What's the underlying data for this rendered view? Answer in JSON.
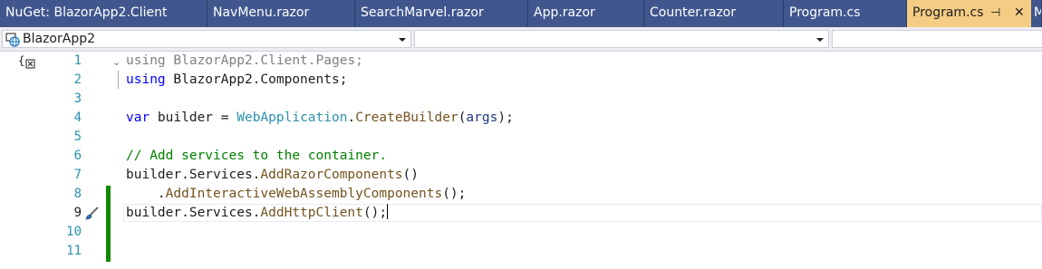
{
  "tabs": [
    {
      "label": "NuGet: BlazorApp2.Client",
      "active": false
    },
    {
      "label": "NavMenu.razor",
      "active": false
    },
    {
      "label": "SearchMarvel.razor",
      "active": false
    },
    {
      "label": "App.razor",
      "active": false
    },
    {
      "label": "Counter.razor",
      "active": false
    },
    {
      "label": "Program.cs",
      "active": false
    },
    {
      "label": "Program.cs",
      "active": true
    },
    {
      "label": "M",
      "active": false
    }
  ],
  "navbar": {
    "project": "BlazorApp2",
    "type_member": "",
    "member": ""
  },
  "editor": {
    "line_numbers": [
      "1",
      "2",
      "3",
      "4",
      "5",
      "6",
      "7",
      "8",
      "9",
      "10",
      "11"
    ],
    "current_line": "9",
    "lines": {
      "l1_using": "using",
      "l1_rest": " BlazorApp2.Client.Pages;",
      "l2_using": "using",
      "l2_rest": " BlazorApp2.Components;",
      "l4_var": "var",
      "l4_builder": " builder = ",
      "l4_type": "WebApplication",
      "l4_dot": ".",
      "l4_method": "CreateBuilder",
      "l4_open": "(",
      "l4_param": "args",
      "l4_close": ");",
      "l6_comment": "// Add services to the container.",
      "l7_a": "builder.Services.",
      "l7_method": "AddRazorComponents",
      "l7_b": "()",
      "l8_a": "    .",
      "l8_method": "AddInteractiveWebAssemblyComponents",
      "l8_b": "();",
      "l9_a": "builder.Services.",
      "l9_method": "AddHttpClient",
      "l9_b": "();"
    }
  },
  "colors": {
    "tabbar": "#40568d",
    "active_tab": "#f5cc84",
    "keyword": "#0000ff",
    "type": "#2b91af",
    "method": "#74531f",
    "comment": "#008000",
    "change_bar": "#108a00"
  }
}
